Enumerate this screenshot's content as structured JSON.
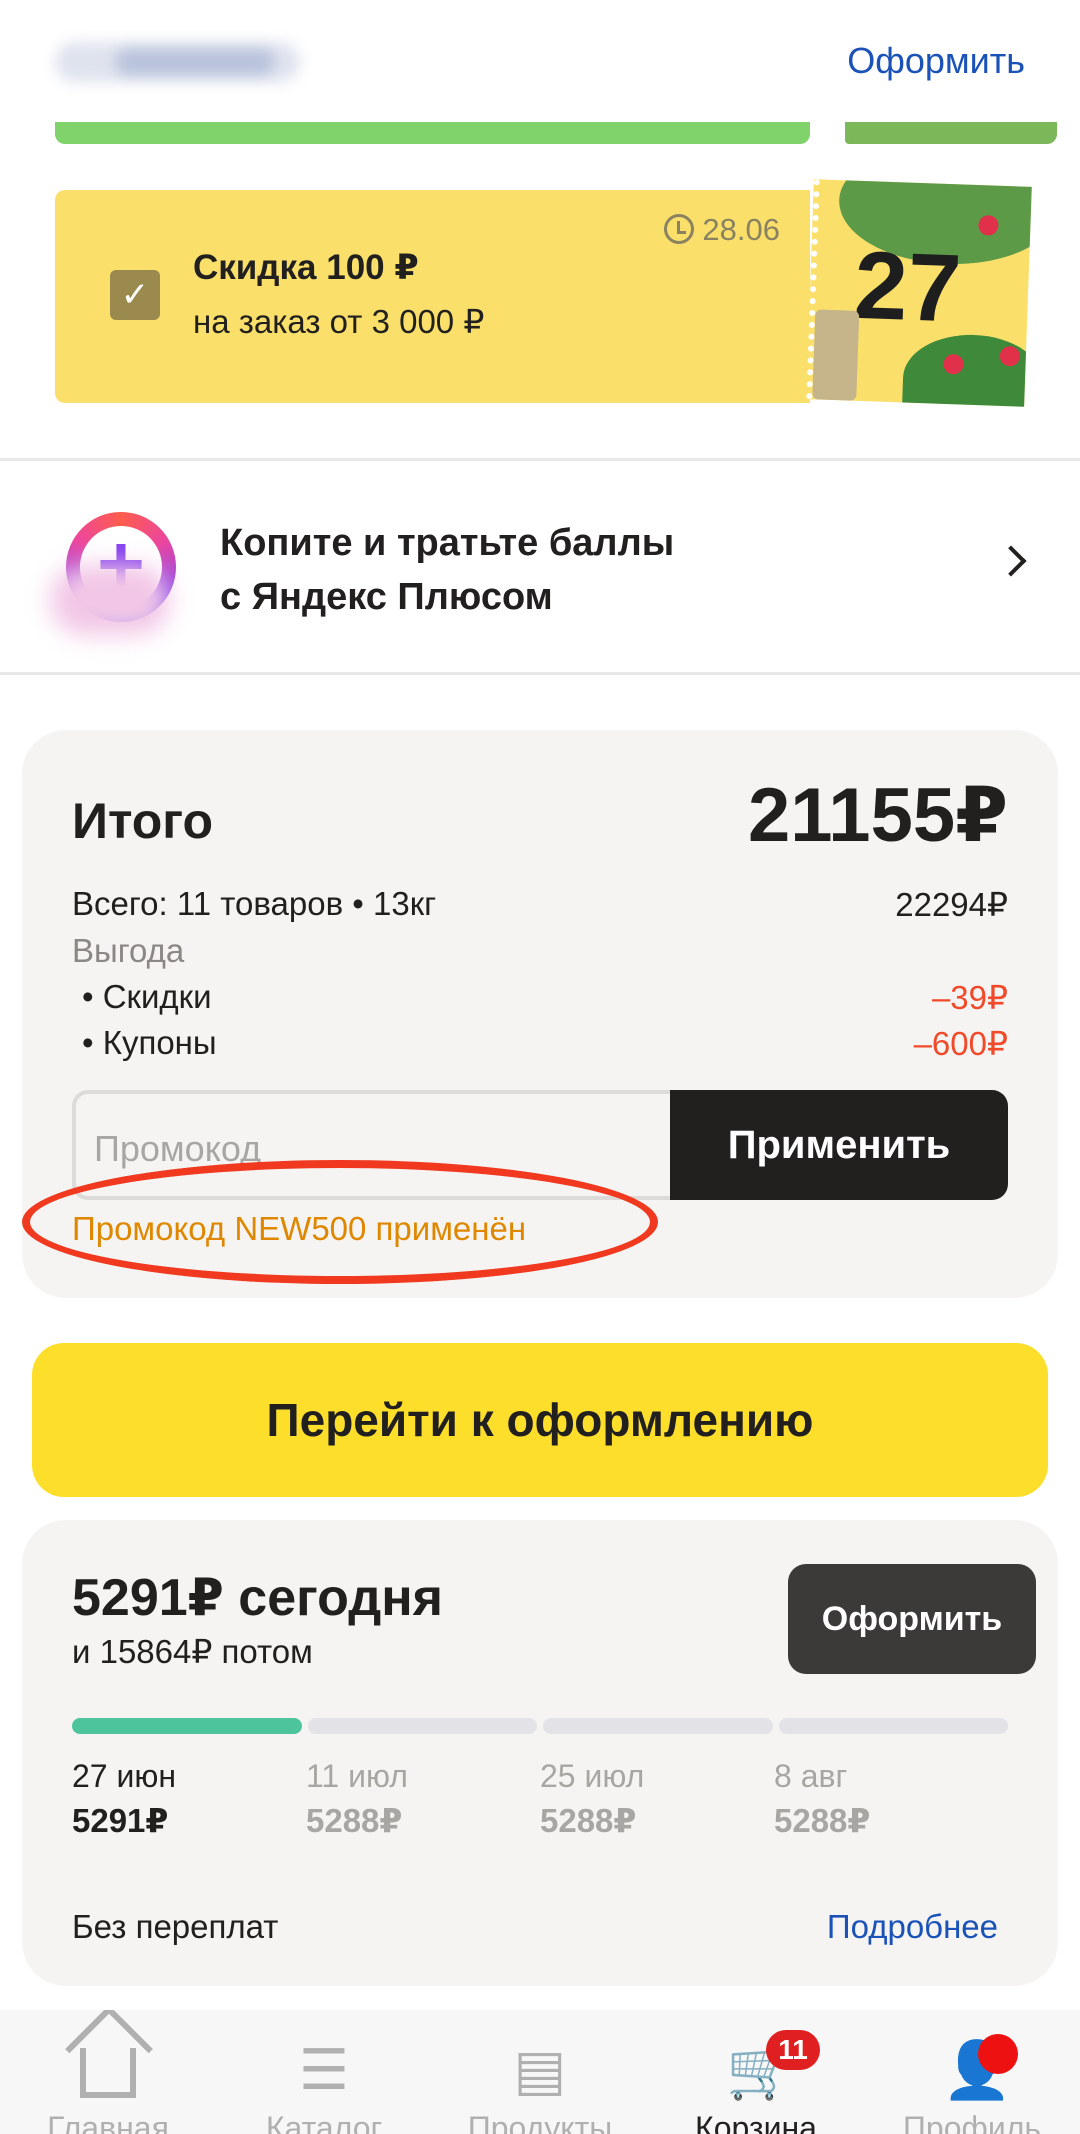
{
  "header": {
    "checkout_link": "Оформить"
  },
  "coupon": {
    "title": "Скидка 100 ₽",
    "subtitle": "на заказ от 3 000 ₽",
    "expires": "28.06",
    "art_number": "27",
    "checked": true,
    "accent_color": "#fae06b"
  },
  "plus": {
    "text_line1": "Копите и тратьте баллы",
    "text_line2": "с Яндекс Плюсом",
    "logo_glyph": "+"
  },
  "total": {
    "label": "Итого",
    "amount": "21155₽",
    "items_label": "Всего: 11 товаров • 13кг",
    "items_value": "22294₽",
    "savings_label": "Выгода",
    "discounts_label": "• Скидки",
    "discounts_value": "–39₽",
    "coupons_label": "• Купоны",
    "coupons_value": "–600₽",
    "promo_placeholder": "Промокод",
    "apply_label": "Применить",
    "promo_applied": "Промокод NEW500 применён"
  },
  "checkout_button": "Перейти к оформлению",
  "split": {
    "today": "5291₽ сегодня",
    "later": "и 15864₽ потом",
    "pay_button": "Оформить",
    "schedule": [
      {
        "date": "27 июн",
        "amount": "5291₽"
      },
      {
        "date": "11 июл",
        "amount": "5288₽"
      },
      {
        "date": "25 июл",
        "amount": "5288₽"
      },
      {
        "date": "8 авг",
        "amount": "5288₽"
      }
    ],
    "no_overpay": "Без переплат",
    "more": "Подробнее",
    "progress_color": "#4dc49c"
  },
  "nav": {
    "items": [
      {
        "label": "Главная",
        "icon": "home-icon"
      },
      {
        "label": "Каталог",
        "icon": "catalog-search-icon"
      },
      {
        "label": "Продукты",
        "icon": "store-icon"
      },
      {
        "label": "Корзина",
        "icon": "cart-icon",
        "badge": "11"
      },
      {
        "label": "Профиль",
        "icon": "profile-icon"
      }
    ]
  }
}
